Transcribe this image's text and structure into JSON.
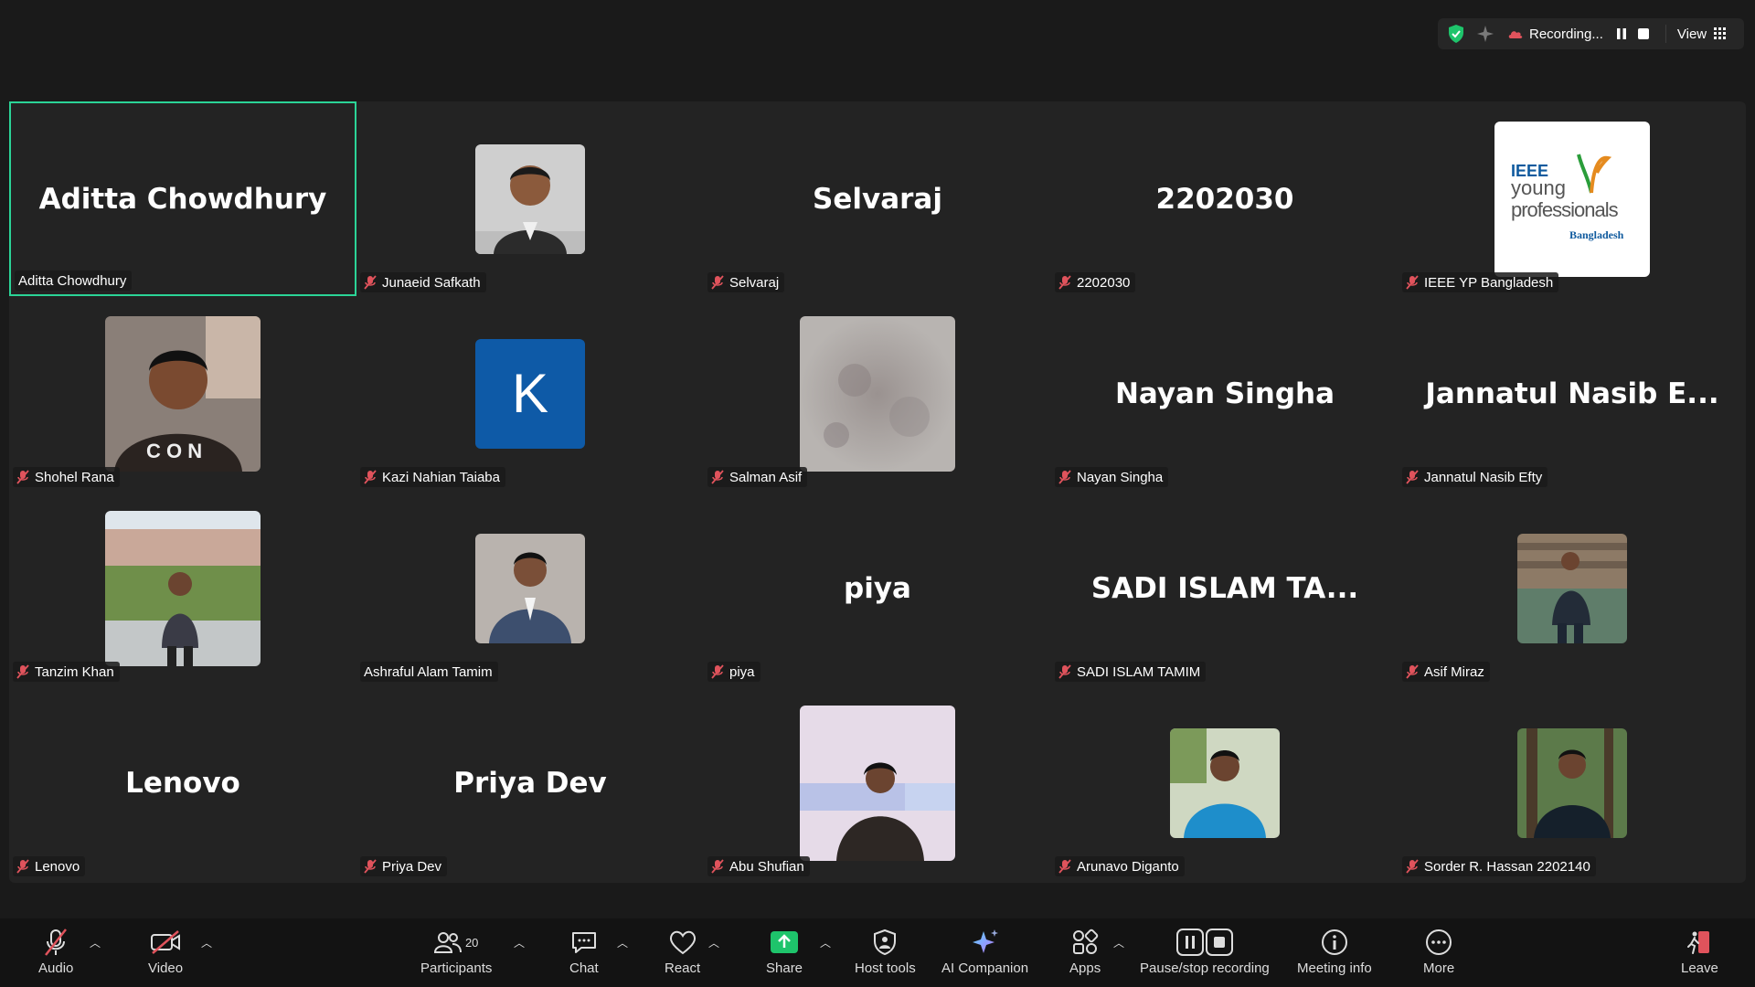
{
  "topbar": {
    "recording_label": "Recording...",
    "view_label": "View",
    "icons": [
      "shield-check-icon",
      "ai-sparkle-icon",
      "cloud-recording-icon",
      "pause-icon",
      "stop-icon",
      "grid-icon"
    ]
  },
  "gallery": {
    "tiles": [
      {
        "name": "Aditta Chowdhury",
        "big": "Aditta Chowdhury",
        "muted": false,
        "active": true
      },
      {
        "name": "Junaeid Safkath",
        "photo": true,
        "muted": true
      },
      {
        "name": "Selvaraj",
        "big": "Selvaraj",
        "muted": true
      },
      {
        "name": "2202030",
        "big": "2202030",
        "muted": true
      },
      {
        "name": "IEEE YP Bangladesh",
        "logo": true,
        "muted": true
      },
      {
        "name": "Shohel Rana",
        "photo": true,
        "muted": true
      },
      {
        "name": "Kazi Nahian Taiaba",
        "letter": "K",
        "muted": true
      },
      {
        "name": "Salman Asif",
        "photo": true,
        "muted": true
      },
      {
        "name": "Nayan Singha",
        "big": "Nayan Singha",
        "muted": true
      },
      {
        "name": "Jannatul Nasib Efty",
        "big": "Jannatul Nasib E...",
        "muted": true
      },
      {
        "name": "Tanzim Khan",
        "photo": true,
        "muted": true
      },
      {
        "name": "Ashraful Alam Tamim",
        "photo": true,
        "muted": false
      },
      {
        "name": "piya",
        "big": "piya",
        "muted": true
      },
      {
        "name": "SADI ISLAM TAMIM",
        "big": "SADI ISLAM TA...",
        "muted": true
      },
      {
        "name": "Asif Miraz",
        "photo": true,
        "muted": true
      },
      {
        "name": "Lenovo",
        "big": "Lenovo",
        "muted": true
      },
      {
        "name": "Priya Dev",
        "big": "Priya Dev",
        "muted": true
      },
      {
        "name": "Abu Shufian",
        "photo": true,
        "muted": true
      },
      {
        "name": "Arunavo Diganto",
        "photo": true,
        "muted": true
      },
      {
        "name": "Sorder R. Hassan 2202140",
        "photo": true,
        "muted": true
      }
    ],
    "ieee_logo": {
      "line1": "IEEE",
      "line2": "young",
      "line3": "professionals",
      "line4": "Bangladesh"
    }
  },
  "toolbar": {
    "audio": "Audio",
    "video": "Video",
    "participants": "Participants",
    "participants_count": "20",
    "chat": "Chat",
    "react": "React",
    "share": "Share",
    "host_tools": "Host tools",
    "ai_companion": "AI Companion",
    "apps": "Apps",
    "pause_stop_recording": "Pause/stop recording",
    "meeting_info": "Meeting info",
    "more": "More",
    "leave": "Leave"
  },
  "colors": {
    "active_border": "#2bd497",
    "share_green": "#1ec46b",
    "mute_red": "#e0535c",
    "ieee_blue": "#0f5a9e"
  }
}
